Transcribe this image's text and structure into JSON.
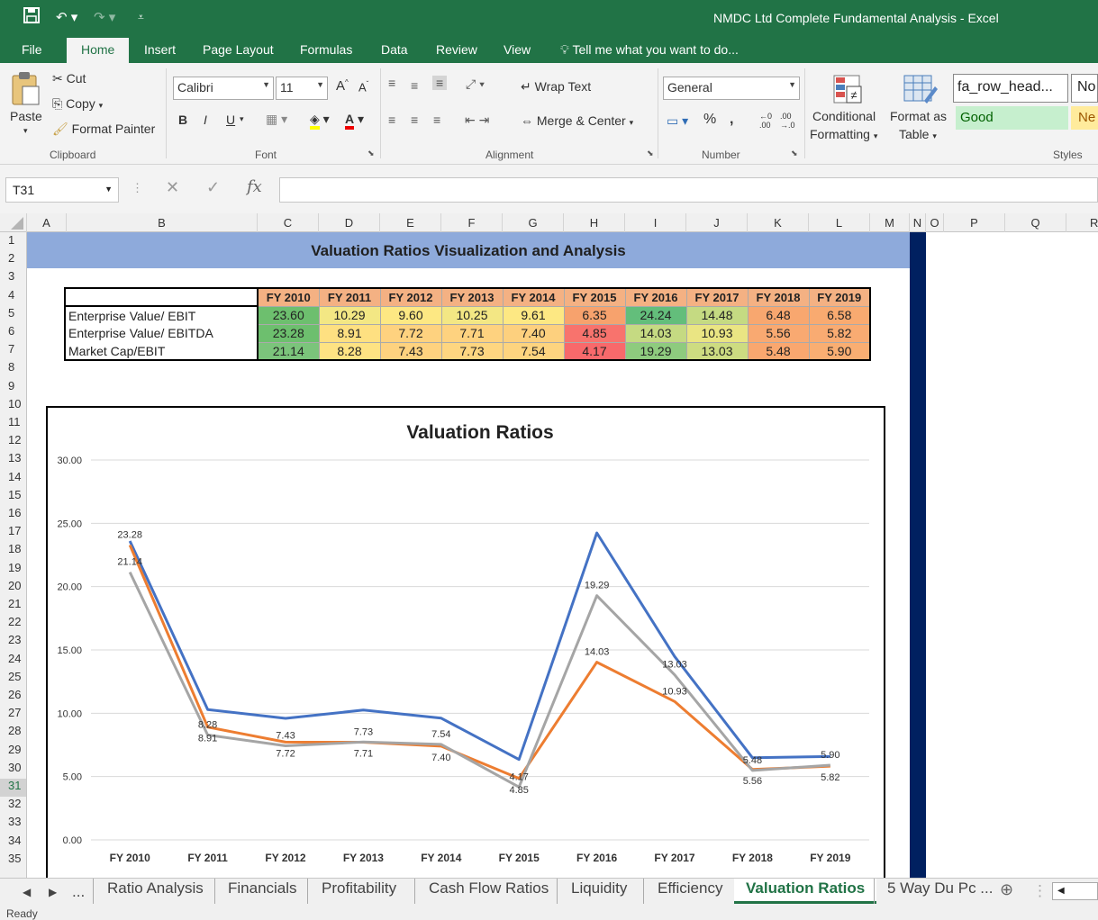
{
  "window": {
    "title": "NMDC Ltd Complete Fundamental Analysis - Excel"
  },
  "ribbon_tabs": [
    {
      "label": "File"
    },
    {
      "label": "Home"
    },
    {
      "label": "Insert"
    },
    {
      "label": "Page Layout"
    },
    {
      "label": "Formulas"
    },
    {
      "label": "Data"
    },
    {
      "label": "Review"
    },
    {
      "label": "View"
    }
  ],
  "tell_me": "Tell me what you want to do...",
  "clipboard": {
    "paste": "Paste",
    "cut": "Cut",
    "copy": "Copy",
    "format_painter": "Format Painter",
    "group": "Clipboard"
  },
  "font": {
    "name": "Calibri",
    "size": "11",
    "bold": "B",
    "italic": "I",
    "underline": "U",
    "group": "Font"
  },
  "alignment": {
    "wrap": "Wrap Text",
    "merge": "Merge & Center",
    "group": "Alignment"
  },
  "number": {
    "format": "General",
    "percent": "%",
    "comma": ",",
    "group": "Number"
  },
  "styles": {
    "conditional": "Conditional",
    "conditional2": "Formatting",
    "format_as": "Format as",
    "format_as2": "Table",
    "cell1": "fa_row_head...",
    "cell2": "No",
    "good": "Good",
    "neutral": "Ne",
    "group": "Styles"
  },
  "formula_bar": {
    "name_box": "T31",
    "formula": ""
  },
  "columns": [
    "A",
    "B",
    "C",
    "D",
    "E",
    "F",
    "G",
    "H",
    "I",
    "J",
    "K",
    "L",
    "M",
    "N",
    "O",
    "P",
    "Q",
    "R"
  ],
  "rows": [
    "1",
    "2",
    "3",
    "4",
    "5",
    "6",
    "7",
    "8",
    "9",
    "10",
    "11",
    "12",
    "13",
    "14",
    "15",
    "16",
    "17",
    "18",
    "19",
    "20",
    "21",
    "22",
    "23",
    "24",
    "25",
    "26",
    "27",
    "28",
    "29",
    "30",
    "31",
    "32",
    "33",
    "34",
    "35"
  ],
  "selected_row": "31",
  "sheet_title": "Valuation Ratios Visualization and Analysis",
  "table": {
    "years": [
      "FY 2010",
      "FY 2011",
      "FY 2012",
      "FY 2013",
      "FY 2014",
      "FY 2015",
      "FY 2016",
      "FY 2017",
      "FY 2018",
      "FY 2019"
    ],
    "rows": [
      {
        "label": "Enterprise Value/ EBIT",
        "values": [
          "23.60",
          "10.29",
          "9.60",
          "10.25",
          "9.61",
          "6.35",
          "24.24",
          "14.48",
          "6.48",
          "6.58"
        ],
        "colors": [
          "#6dbf6e",
          "#f3e784",
          "#fde883",
          "#f3e784",
          "#fde883",
          "#f7a26d",
          "#63be7b",
          "#c5da82",
          "#f8a76f",
          "#f9aa70"
        ]
      },
      {
        "label": "Enterprise Value/ EBITDA",
        "values": [
          "23.28",
          "8.91",
          "7.72",
          "7.71",
          "7.40",
          "4.85",
          "14.03",
          "10.93",
          "5.56",
          "5.82"
        ],
        "colors": [
          "#6dbf6e",
          "#fee081",
          "#fed27f",
          "#fed27f",
          "#fdd07e",
          "#f8736d",
          "#c5da82",
          "#eae583",
          "#f9a971",
          "#f9ab72"
        ]
      },
      {
        "label": "Market Cap/EBIT",
        "values": [
          "21.14",
          "8.28",
          "7.43",
          "7.73",
          "7.54",
          "4.17",
          "19.29",
          "13.03",
          "5.48",
          "5.90"
        ],
        "colors": [
          "#7bc47b",
          "#fee383",
          "#fed27f",
          "#fed680",
          "#fdd47f",
          "#f8696b",
          "#8ecb7e",
          "#cddc81",
          "#f9a76f",
          "#f9ae72"
        ]
      }
    ]
  },
  "chart_data": {
    "type": "line",
    "title": "Valuation Ratios",
    "categories": [
      "FY 2010",
      "FY 2011",
      "FY 2012",
      "FY 2013",
      "FY 2014",
      "FY 2015",
      "FY 2016",
      "FY 2017",
      "FY 2018",
      "FY 2019"
    ],
    "ylim": [
      0,
      30
    ],
    "yticks": [
      "0.00",
      "5.00",
      "10.00",
      "15.00",
      "20.00",
      "25.00",
      "30.00"
    ],
    "grid": true,
    "series": [
      {
        "color": "#4472c4",
        "values": [
          23.6,
          10.29,
          9.6,
          10.25,
          9.61,
          6.35,
          24.24,
          14.48,
          6.48,
          6.58
        ],
        "labels": false
      },
      {
        "color": "#ed7d31",
        "values": [
          23.28,
          8.91,
          7.72,
          7.71,
          7.4,
          4.85,
          14.03,
          10.93,
          5.56,
          5.82
        ],
        "labels": true,
        "label_pos": [
          "above",
          "below",
          "below",
          "below",
          "below",
          "below",
          "above",
          "above",
          "below",
          "below"
        ]
      },
      {
        "color": "#a5a5a5",
        "values": [
          21.14,
          8.28,
          7.43,
          7.73,
          7.54,
          4.17,
          19.29,
          13.03,
          5.48,
          5.9
        ],
        "labels": true,
        "label_pos": [
          "above",
          "above",
          "above",
          "above",
          "above",
          "above",
          "above",
          "above",
          "above",
          "above"
        ]
      }
    ]
  },
  "sheet_tabs": [
    "...",
    "Ratio Analysis",
    "Financials",
    "Profitability",
    "Cash Flow Ratios",
    "Liquidity",
    "Efficiency",
    "Valuation Ratios",
    "5 Way Du Pc ..."
  ],
  "active_sheet": "Valuation Ratios",
  "status": "Ready",
  "icons": [
    "save-icon",
    "undo-icon",
    "redo-icon",
    "customize-icon",
    "lightbulb-icon",
    "cut-icon",
    "copy-icon",
    "paste-icon",
    "format-painter-icon",
    "font-grow-icon",
    "font-shrink-icon",
    "borders-icon",
    "fill-color-icon",
    "font-color-icon",
    "align-icon",
    "orientation-icon",
    "indent-icon",
    "currency-icon",
    "decimal-icon",
    "conditional-formatting-icon",
    "format-table-icon",
    "cancel-icon",
    "enter-icon",
    "fx-icon",
    "add-sheet-icon",
    "scroll-left-icon",
    "scroll-right-icon"
  ]
}
